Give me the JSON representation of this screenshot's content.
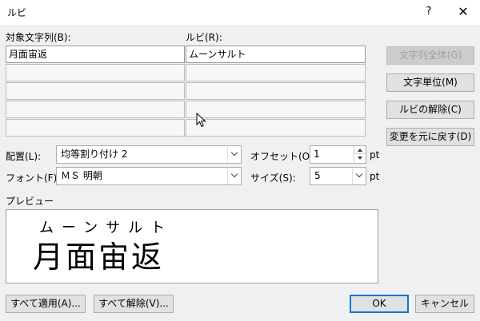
{
  "window": {
    "title": "ルビ",
    "help": "?",
    "close": "✕"
  },
  "labels": {
    "target": "対象文字列(B):",
    "ruby": "ルビ(R):",
    "align": "配置(L):",
    "offset": "オフセット(O):",
    "font": "フォント(F):",
    "size": "サイズ(S):",
    "preview": "プレビュー",
    "unit_pt": "pt"
  },
  "grid": {
    "rows": [
      {
        "base": "月面宙返",
        "ruby": "ムーンサルト"
      },
      {
        "base": "",
        "ruby": ""
      },
      {
        "base": "",
        "ruby": ""
      },
      {
        "base": "",
        "ruby": ""
      },
      {
        "base": "",
        "ruby": ""
      }
    ]
  },
  "side_buttons": {
    "whole_string": "文字列全体(G)",
    "per_char": "文字単位(M)",
    "remove_ruby": "ルビの解除(C)",
    "reset": "変更を元に戻す(D)"
  },
  "fields": {
    "align_value": "均等割り付け 2",
    "offset_value": "1",
    "font_value": "ＭＳ 明朝",
    "size_value": "5"
  },
  "preview": {
    "ruby_text": "ムーンサルト",
    "base_text": "月面宙返"
  },
  "footer": {
    "apply_all": "すべて適用(A)...",
    "remove_all": "すべて解除(V)...",
    "ok": "OK",
    "cancel": "キャンセル"
  },
  "colors": {
    "client_bg": "#f0f0f0",
    "default_button_border": "#0078d7"
  }
}
